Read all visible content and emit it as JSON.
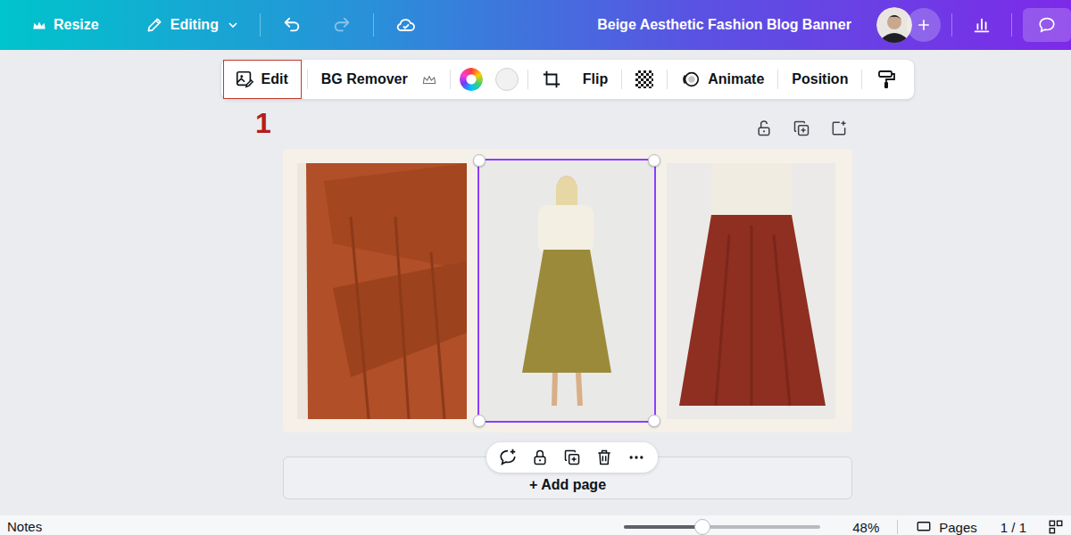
{
  "topbar": {
    "resize": "Resize",
    "mode": "Editing",
    "title": "Beige Aesthetic Fashion Blog Banner",
    "undo_enabled": true,
    "redo_enabled": false
  },
  "toolbar": {
    "edit": {
      "label": "Edit",
      "highlighted": true
    },
    "bg_remover": "BG Remover",
    "flip": "Flip",
    "animate": "Animate",
    "position": "Position"
  },
  "annotation": {
    "label": "1"
  },
  "design": {
    "photos": [
      {
        "selected": false
      },
      {
        "selected": true
      },
      {
        "selected": false
      }
    ]
  },
  "add_page": "+ Add page",
  "status_bar": {
    "notes": "Notes",
    "zoom": {
      "level": 0.4,
      "reading": "48%"
    },
    "pages": "Pages",
    "page_count": "1 / 1"
  }
}
